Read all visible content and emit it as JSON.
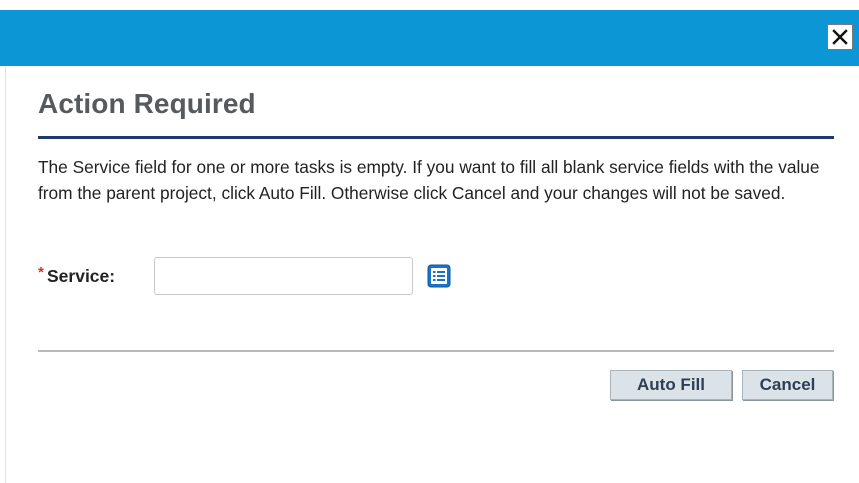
{
  "dialog": {
    "title": "Action Required",
    "message": "The Service field for one or more tasks is empty. If you want to fill all blank service fields with the value from the parent project, click Auto Fill. Otherwise click Cancel and your changes will not be saved.",
    "close_icon": "close-icon"
  },
  "service_field": {
    "required_marker": "*",
    "label": "Service:",
    "value": "",
    "placeholder": "",
    "picker_icon": "list-icon"
  },
  "buttons": {
    "auto_fill": "Auto Fill",
    "cancel": "Cancel"
  },
  "colors": {
    "titlebar": "#0c96d6",
    "heading": "#555a5f",
    "heading_rule": "#1c3b6a",
    "button_bg": "#dbe2e8",
    "button_text": "#2e3e55",
    "required": "#d0312d"
  }
}
